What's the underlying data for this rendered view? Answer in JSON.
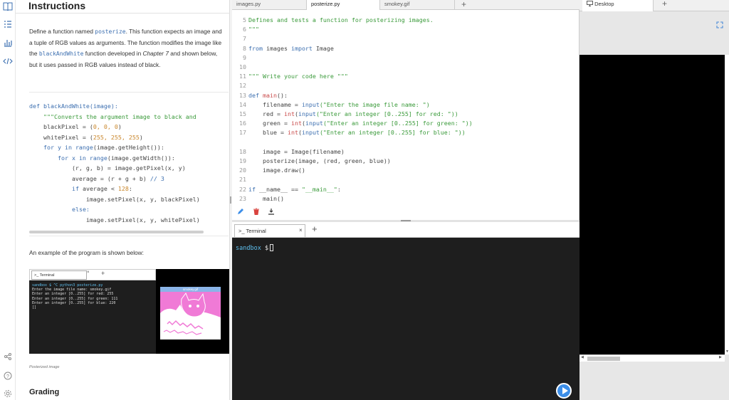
{
  "instructions": {
    "title": "Instructions",
    "para": {
      "p1": "Define a function named ",
      "fn_name": "posterize",
      "p2": ". This function expects an image and a tuple of RGB values as arguments. The function modifies the image like the ",
      "bw_name": "blackAndWhite",
      "p3": " function developed in ",
      "chapter": "Chapter 7",
      "p4": " and shown below, but it uses passed in RGB values instead of black."
    },
    "code": {
      "l1_kw": "def ",
      "l1_fn": "blackAndWhite(image):",
      "l2": "    \"\"\"Converts the argument image to black and",
      "l3a": "    blackPixel = (",
      "l3b": "0, 0, 0",
      "l3c": ")",
      "l4a": "    whitePixel = (",
      "l4b": "255, 255, 255",
      "l4c": ")",
      "l5a": "    ",
      "l5b": "for y in range",
      "l5c": "(image.getHeight()):",
      "l6a": "        ",
      "l6b": "for x in range",
      "l6c": "(image.getWidth()):",
      "l7": "            (r, g, b) = image.getPixel(x, y)",
      "l8a": "            average = (r + g + b) ",
      "l8b": "// 3",
      "l9a": "            ",
      "l9b": "if",
      "l9c": " average < ",
      "l9d": "128",
      "l9e": ":",
      "l10": "                image.setPixel(x, y, blackPixel)",
      "l11a": "            ",
      "l11b": "else:",
      "l12": "                image.setPixel(x, y, whitePixel)"
    },
    "example_text": "An example of the program is shown below:",
    "example_terminal": {
      "tab_label": ">_ Terminal",
      "tab_close": "×",
      "tab_add": "+",
      "lines": [
        "sandbox $ ^C python3 posterize.py",
        "Enter the image file name: smokey.gif",
        "Enter an integer [0..255] for red: 255",
        "Enter an integer [0..255] for green: 111",
        "Enter an integer [0..255] for blue: 220",
        "[]"
      ]
    },
    "example_image_title": "smokey.gif",
    "caption": "Posterized image",
    "grading": "Grading"
  },
  "editor": {
    "tabs": [
      "images.py",
      "posterize.py",
      "smokey.gif"
    ],
    "active_tab": "posterize.py",
    "add_tab": "+",
    "line_numbers": [
      "5",
      "6",
      "7",
      "8",
      "9",
      "10",
      "11",
      "12",
      "13",
      "14",
      "15",
      "16",
      "17",
      "",
      "18",
      "19",
      "20",
      "21",
      "22",
      "23"
    ],
    "code": {
      "l5": "Defines and tests a function for posterizing images.",
      "l6": "\"\"\"",
      "l8a": "from",
      "l8b": " images ",
      "l8c": "import",
      "l8d": " Image",
      "l11": "\"\"\" Write your code here \"\"\"",
      "l13a": "def",
      "l13b": " main",
      "l13c": "():",
      "l14a": "    filename = ",
      "l14b": "input",
      "l14c": "(\"Enter the image file name: \")",
      "l15a": "    red = ",
      "l15b": "int",
      "l15c": "(",
      "l15d": "input",
      "l15e": "(\"Enter an integer [0..255] for red: \"))",
      "l16a": "    green = ",
      "l16b": "int",
      "l16c": "(",
      "l16d": "input",
      "l16e": "(\"Enter an integer [0..255] for green: \"))",
      "l17a": "    blue = ",
      "l17b": "int",
      "l17c": "(",
      "l17d": "input",
      "l17e": "(\"Enter an integer [0..255] for blue: \"))",
      "l18": "    image = Image(filename)",
      "l19": "    posterize(image, (red, green, blue))",
      "l20": "    image.draw()",
      "l22a": "if",
      "l22b": " __name__ == ",
      "l22c": "\"__main__\"",
      "l22d": ":",
      "l23": "    main()"
    }
  },
  "terminal": {
    "tab_label": ">_ Terminal",
    "tab_close": "×",
    "tab_add": "+",
    "prompt_host": "sandbox",
    "prompt_symbol": "$"
  },
  "desktop": {
    "tab_label": "Desktop",
    "add_tab": "+"
  },
  "colors": {
    "accent": "#3c6fb0",
    "string": "#3a9a3a",
    "number": "#c9862a",
    "terminal_bg": "#1e1e1e",
    "play_button": "#3c8ee8",
    "posterized_pink": "#f07ad6"
  },
  "icons": [
    "book-icon",
    "list-icon",
    "chart-icon",
    "code-icon",
    "share-icon",
    "help-icon",
    "settings-icon",
    "pencil-icon",
    "trash-icon",
    "download-icon",
    "fullscreen-icon",
    "play-icon",
    "desktop-icon"
  ]
}
